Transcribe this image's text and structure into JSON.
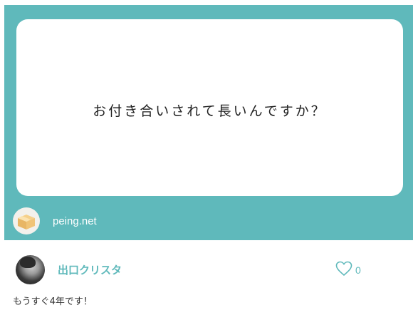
{
  "question": {
    "text": "お付き合いされて長いんですか？",
    "card_color": "#5fb9bb",
    "brand": {
      "name": "peing.net",
      "logo_icon": "cardboard-box-icon"
    }
  },
  "answer": {
    "user": {
      "name": "出口クリスタ",
      "avatar_icon": "user-avatar"
    },
    "like": {
      "icon": "heart-outline-icon",
      "count": "0"
    },
    "text": "もうすぐ4年です！"
  },
  "colors": {
    "accent": "#5fb9bb",
    "text": "#333333"
  }
}
